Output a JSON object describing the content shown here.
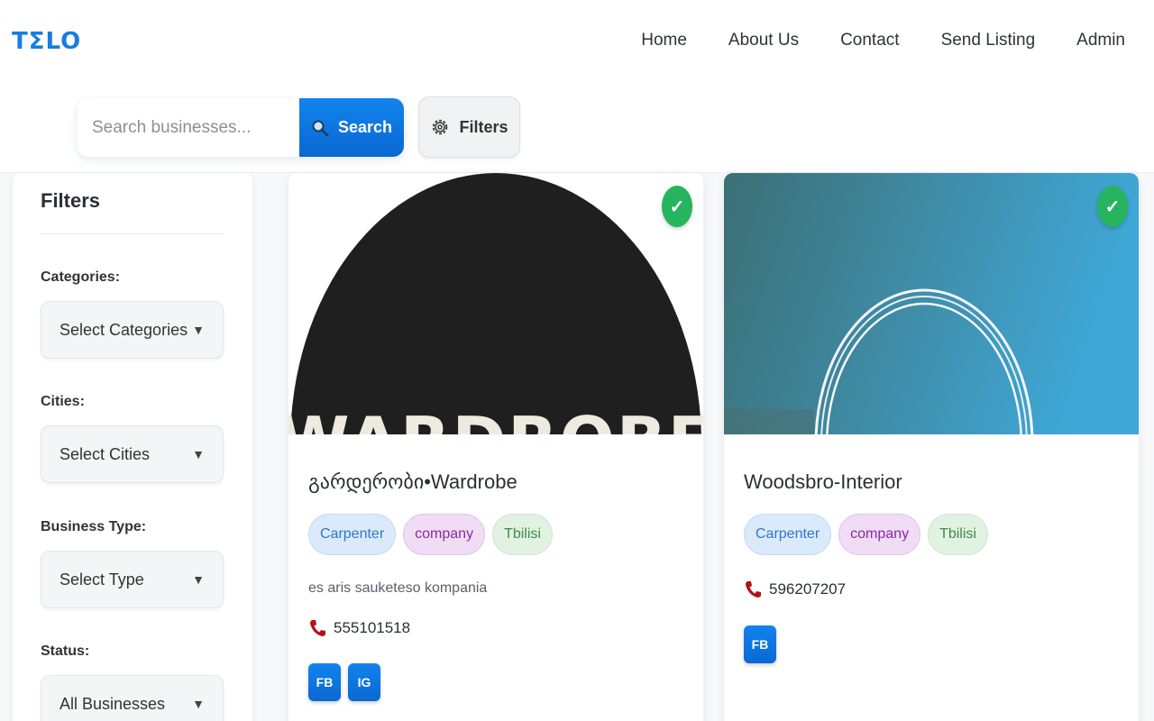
{
  "header": {
    "logo": "TΣLO",
    "nav": [
      "Home",
      "About Us",
      "Contact",
      "Send Listing",
      "Admin"
    ]
  },
  "search": {
    "placeholder": "Search businesses...",
    "button_label": "Search",
    "filters_label": "Filters"
  },
  "sidebar": {
    "title": "Filters",
    "groups": [
      {
        "label": "Categories:",
        "value": "Select Categories"
      },
      {
        "label": "Cities:",
        "value": "Select Cities"
      },
      {
        "label": "Business Type:",
        "value": "Select Type"
      },
      {
        "label": "Status:",
        "value": "All Businesses"
      }
    ]
  },
  "listings": [
    {
      "title": "გარდერობი•Wardrobe",
      "image_text": "WARDROBE",
      "verified": "✓",
      "tags": [
        "Carpenter",
        "company",
        "Tbilisi"
      ],
      "description": "es aris sauketeso kompania",
      "phone": "555101518",
      "socials": [
        "FB",
        "IG"
      ]
    },
    {
      "title": "Woodsbro-Interior",
      "verified": "✓",
      "tags": [
        "Carpenter",
        "company",
        "Tbilisi"
      ],
      "description": "",
      "phone": "596207207",
      "socials": [
        "FB"
      ]
    }
  ],
  "colors": {
    "brand": "#1a7ce0",
    "primary_button": "#0b68d2",
    "verified": "#27b45e"
  },
  "icons": {
    "search": "magnifier-icon",
    "filters": "gear-icon",
    "phone": "phone-icon",
    "verified": "check-icon"
  }
}
